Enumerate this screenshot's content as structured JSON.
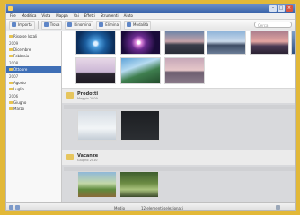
{
  "window": {
    "title": ""
  },
  "menu": [
    "File",
    "Modifica",
    "Vista",
    "Mappa",
    "Vai",
    "Effetti",
    "Strumenti",
    "Aiuto"
  ],
  "toolbar": {
    "buttons": [
      "Importa",
      "Trova",
      "Rinomina",
      "Elimina",
      "Modalità"
    ],
    "search_placeholder": "Cerca"
  },
  "sidebar": {
    "items": [
      {
        "label": "Risorse locali",
        "type": "root"
      },
      {
        "label": "2009",
        "type": "year"
      },
      {
        "label": "Dicembre",
        "type": "folder"
      },
      {
        "label": "Febbraio",
        "type": "folder"
      },
      {
        "label": "2008",
        "type": "year"
      },
      {
        "label": "Ottobre",
        "type": "folder",
        "selected": true
      },
      {
        "label": "2007",
        "type": "year"
      },
      {
        "label": "Agosto",
        "type": "folder"
      },
      {
        "label": "Luglio",
        "type": "folder"
      },
      {
        "label": "2006",
        "type": "year"
      },
      {
        "label": "Giugno",
        "type": "folder"
      },
      {
        "label": "Marzo",
        "type": "folder"
      }
    ]
  },
  "groups": [
    {
      "title": "Prodotti",
      "date": "Maggio 2009"
    },
    {
      "title": "Vacanze",
      "date": "Giugno 2010"
    }
  ],
  "status": {
    "zoom": "Medio",
    "text": "12 elementi selezionati"
  },
  "colors": {
    "frame": "#e2b838",
    "selection": "#3f6fb6"
  }
}
